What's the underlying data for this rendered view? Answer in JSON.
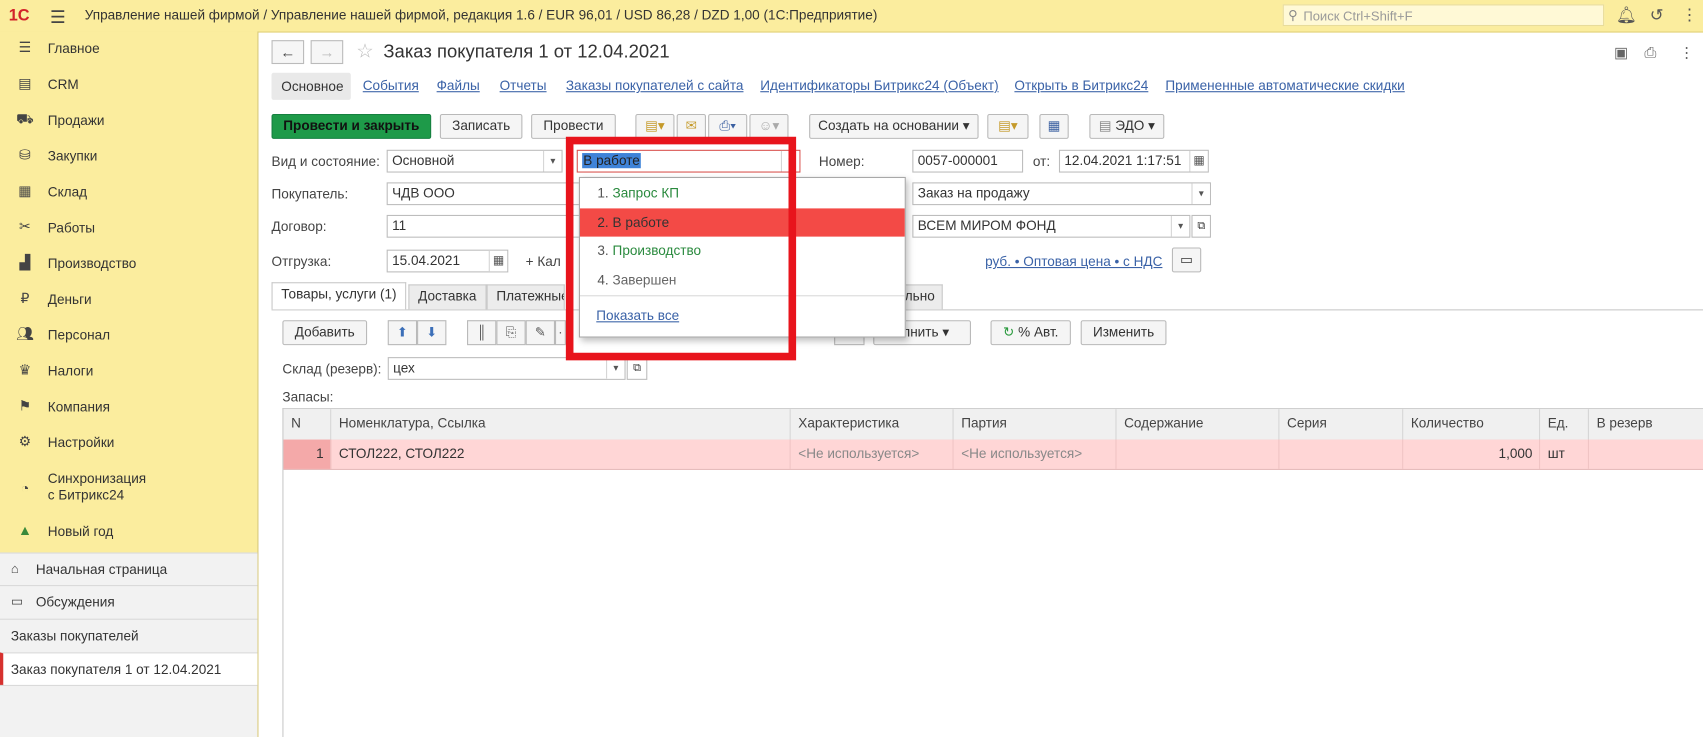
{
  "topbar": {
    "logo": "1С",
    "title": "Управление нашей фирмой / Управление нашей фирмой, редакция 1.6 / EUR 96,01 / USD 86,28 / DZD 1,00  (1С:Предприятие)",
    "search_placeholder": "Поиск Ctrl+Shift+F"
  },
  "sidebar": {
    "items": [
      {
        "label": "Главное",
        "icon": "list-icon"
      },
      {
        "label": "CRM",
        "icon": "crm-icon"
      },
      {
        "label": "Продажи",
        "icon": "cart-icon"
      },
      {
        "label": "Закупки",
        "icon": "purchase-icon"
      },
      {
        "label": "Склад",
        "icon": "warehouse-icon"
      },
      {
        "label": "Работы",
        "icon": "tools-icon"
      },
      {
        "label": "Производство",
        "icon": "factory-icon"
      },
      {
        "label": "Деньги",
        "icon": "money-icon"
      },
      {
        "label": "Персонал",
        "icon": "people-icon"
      },
      {
        "label": "Налоги",
        "icon": "emblem-icon"
      },
      {
        "label": "Компания",
        "icon": "flag-icon"
      },
      {
        "label": "Настройки",
        "icon": "gear-icon"
      },
      {
        "label": "Синхронизация",
        "label2": "с Битрикс24",
        "icon": "sync-icon"
      },
      {
        "label": "Новый год",
        "icon": "tree-icon"
      }
    ],
    "bottom": {
      "home": "Начальная страница",
      "discussions": "Обсуждения",
      "orders": "Заказы покупателей",
      "current": "Заказ покупателя 1 от 12.04.2021"
    }
  },
  "doc": {
    "title": "Заказ покупателя 1 от 12.04.2021",
    "tabs": [
      "Основное",
      "События",
      "Файлы",
      "Отчеты",
      "Заказы покупателей с сайта",
      "Идентификаторы Битрикс24 (Объект)",
      "Открыть в Битрикс24",
      "Примененные автоматические скидки"
    ],
    "buttons": {
      "post_close": "Провести и закрыть",
      "save": "Записать",
      "post": "Провести",
      "create_based": "Создать на основании",
      "edo": "ЭДО"
    },
    "fields": {
      "kind_label": "Вид и состояние:",
      "kind_value": "Основной",
      "state_value": "В работе",
      "number_label": "Номер:",
      "number_value": "0057-000001",
      "from_label": "от:",
      "date_value": "12.04.2021  1:17:51",
      "buyer_label": "Покупатель:",
      "buyer_value": "ЧДВ ООО",
      "operation_value": "Заказ на продажу",
      "contract_label": "Договор:",
      "contract_value": "11",
      "fund_value": "ВСЕМ МИРОМ ФОНД",
      "shipment_label": "Отгрузка:",
      "shipment_value": "15.04.2021",
      "calendar_partial": "+ Кал",
      "price_link": "руб. • Оптовая цена • с НДС"
    },
    "subtabs": [
      "Товары, услуги (1)",
      "Доставка",
      "Платежные",
      "льно"
    ],
    "table_toolbar": {
      "add": "Добавить",
      "fill_partial": "олнить",
      "auto_percent": "% Авт.",
      "change": "Изменить"
    },
    "warehouse_label": "Склад (резерв):",
    "warehouse_value": "цех",
    "stocks_label": "Запасы:",
    "table": {
      "headers": [
        "N",
        "Номенклатура, Ссылка",
        "Характеристика",
        "Партия",
        "Содержание",
        "Серия",
        "Количество",
        "Ед.",
        "В резерв"
      ],
      "rows": [
        [
          "1",
          "СТОЛ222, СТОЛ222",
          "<Не используется>",
          "<Не используется>",
          "",
          "",
          "1,000",
          "шт",
          ""
        ]
      ]
    }
  },
  "popup": {
    "items": [
      {
        "num": "1.",
        "label": "Запрос КП",
        "color": "#2a8a3e"
      },
      {
        "num": "2.",
        "label": "В работе",
        "color": "#333333"
      },
      {
        "num": "3.",
        "label": "Производство",
        "color": "#2a8a3e"
      },
      {
        "num": "4.",
        "label": "Завершен",
        "color": "#666666"
      }
    ],
    "show_all": "Показать все"
  },
  "colors": {
    "highlight": "#e8141c",
    "sidebar_bg": "#fbed9e",
    "primary": "#1e9a49",
    "selected": "#f34a46"
  }
}
